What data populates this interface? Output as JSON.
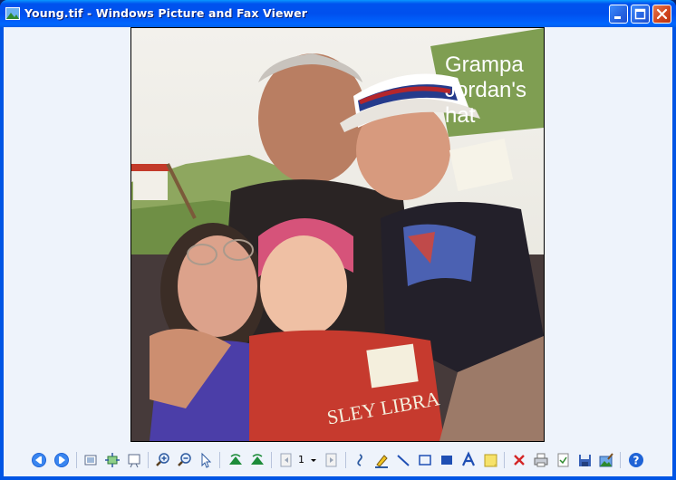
{
  "window": {
    "title": "Young.tif - Windows Picture and Fax Viewer"
  },
  "image": {
    "overlay_text": "Grampa\nJordan's\nhat"
  },
  "toolbar": {
    "page_number": "1",
    "buttons": [
      "previous-image",
      "next-image",
      "best-fit",
      "actual-size",
      "slideshow",
      "zoom-in",
      "zoom-out",
      "select",
      "rotate-clockwise",
      "rotate-counterclockwise",
      "previous-page",
      "page-select",
      "next-page",
      "annotation-freehand",
      "highlighter",
      "line",
      "frame",
      "filled-rectangle",
      "text",
      "note",
      "delete",
      "print",
      "copy-to",
      "save",
      "edit",
      "help"
    ]
  },
  "colors": {
    "titlebar": "#0055e5",
    "client_bg": "#eef3fb",
    "close_button": "#d0431d"
  }
}
